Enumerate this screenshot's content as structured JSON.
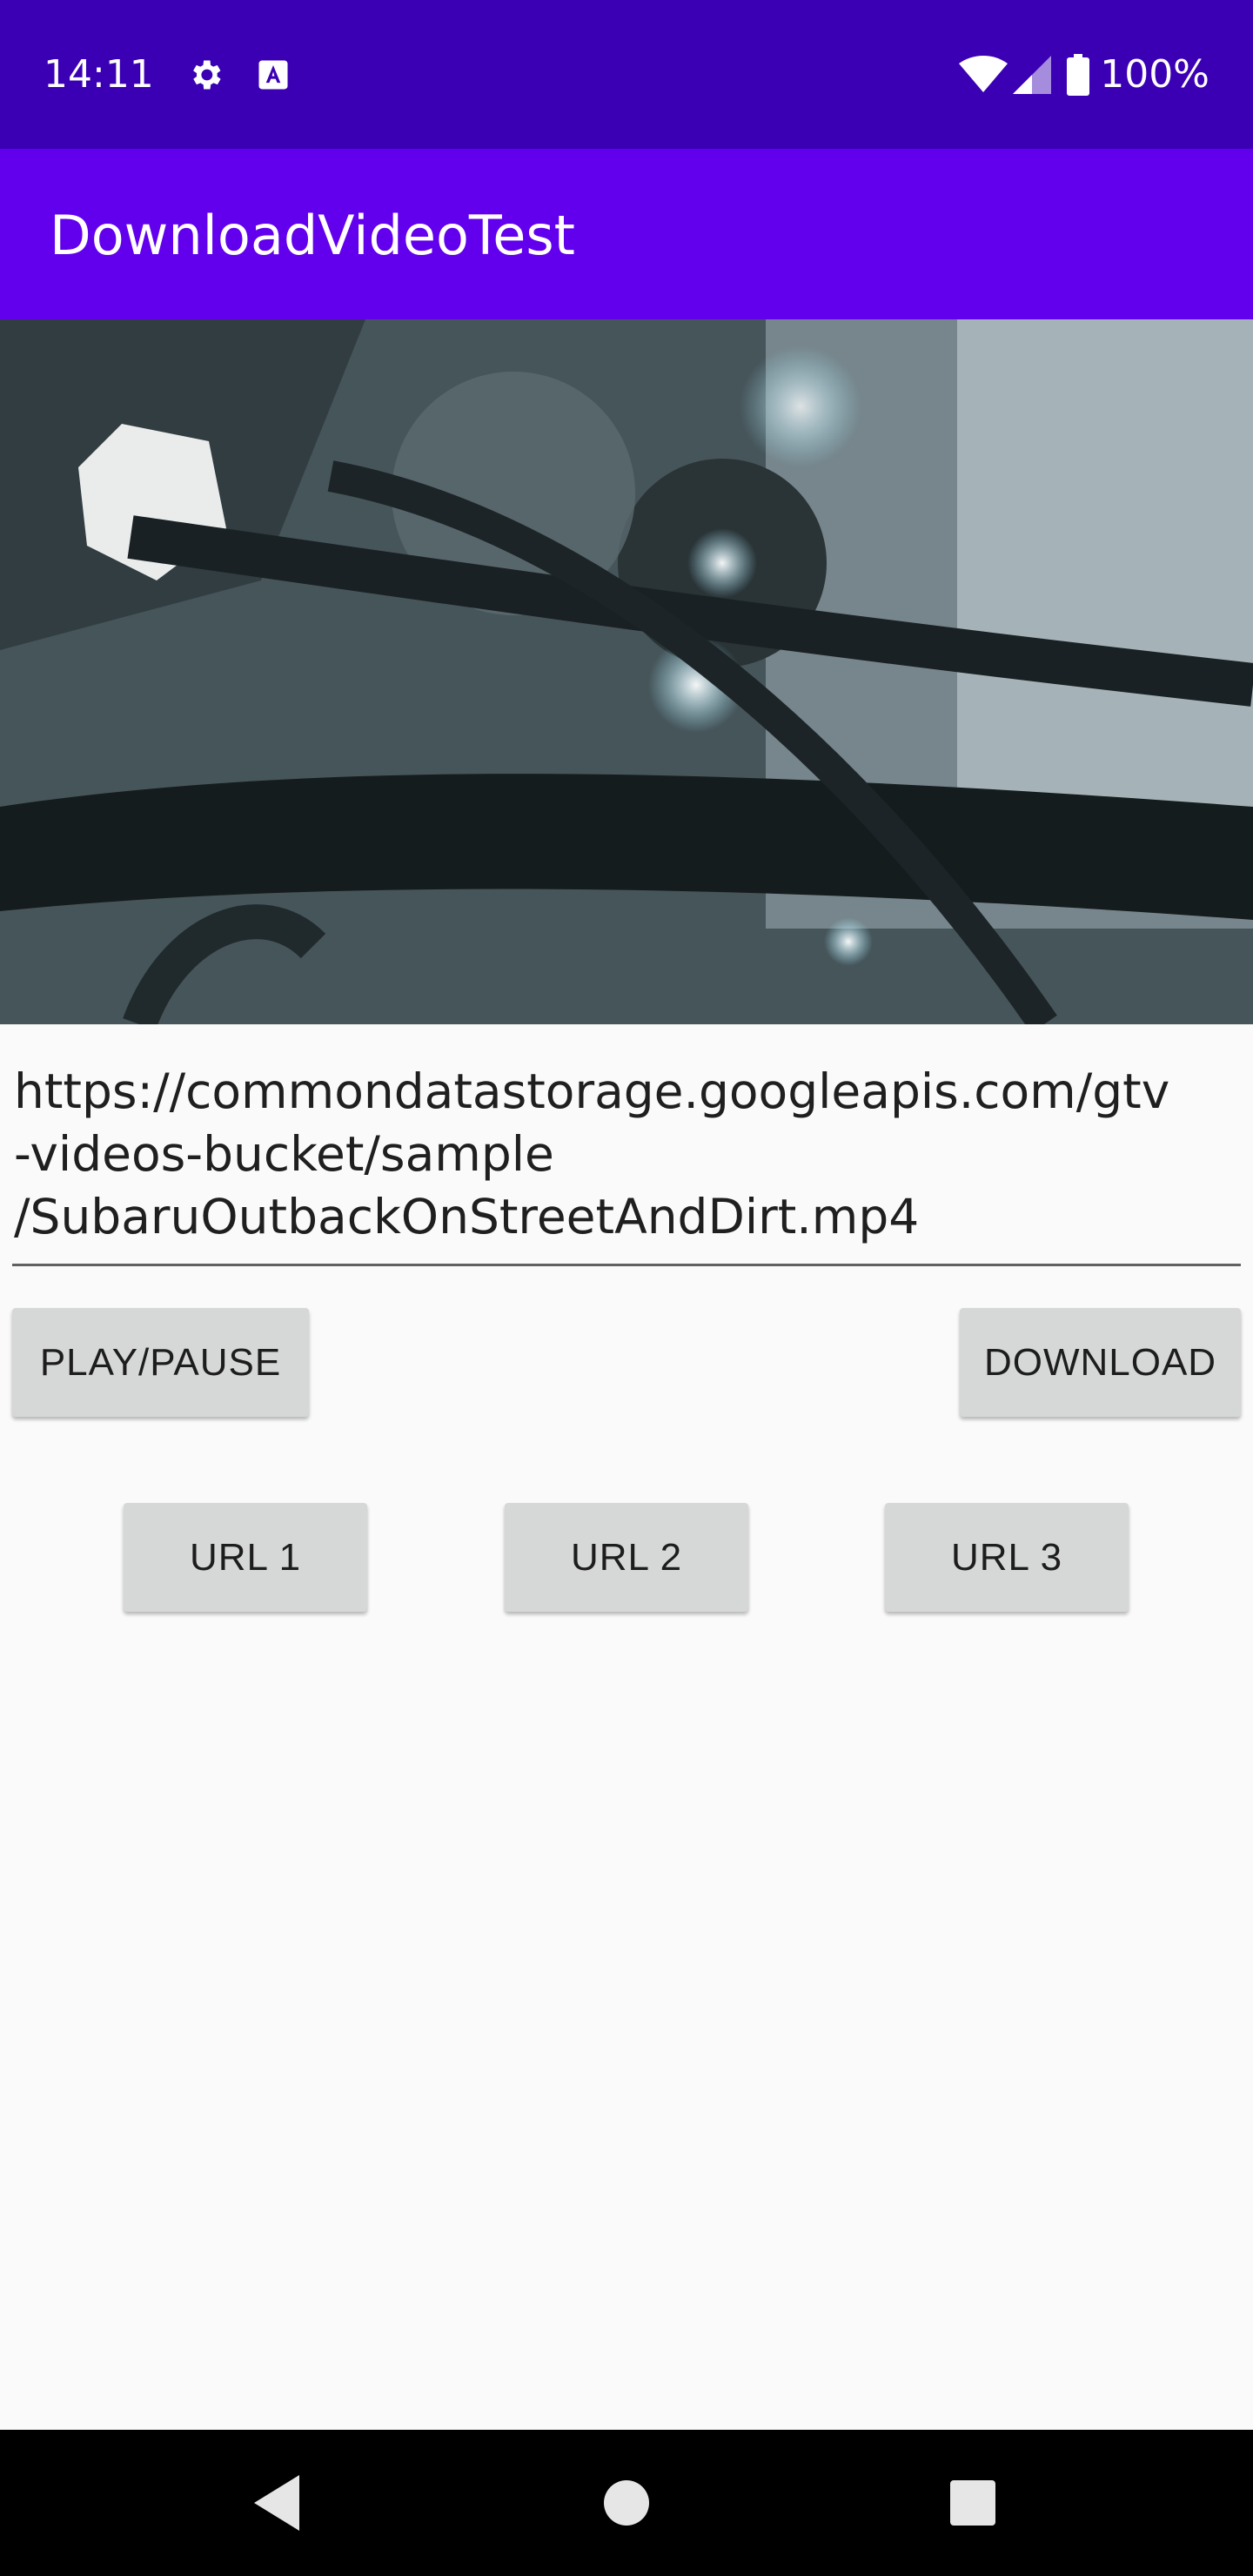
{
  "status_bar": {
    "time": "14:11",
    "battery": "100%",
    "icons": [
      "settings-icon",
      "text-a-icon",
      "wifi-icon",
      "signal-icon",
      "battery-icon"
    ]
  },
  "app_bar": {
    "title": "DownloadVideoTest"
  },
  "video": {
    "icon": "video-frame"
  },
  "url_field": {
    "value": "https://commondatastorage.googleapis.com/gtv\n-videos-bucket/sample\n/SubaruOutbackOnStreetAndDirt.mp4"
  },
  "buttons": {
    "play_pause": "PLAY/PAUSE",
    "download": "DOWNLOAD",
    "url1": "URL 1",
    "url2": "URL 2",
    "url3": "URL 3"
  },
  "nav_bar": {
    "icons": [
      "back-icon",
      "home-icon",
      "recents-icon"
    ]
  },
  "colors": {
    "status_bar": "#3b00b3",
    "app_bar": "#6200ee",
    "background": "#fafafa",
    "button": "#d6d7d7"
  }
}
